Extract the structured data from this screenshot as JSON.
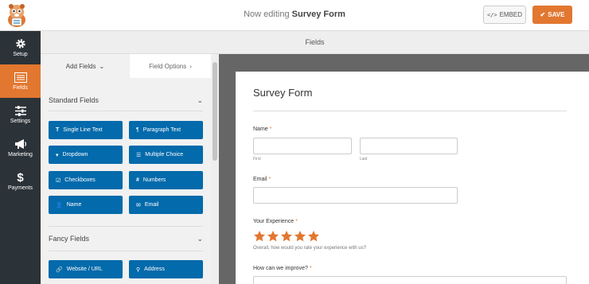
{
  "header": {
    "title_prefix": "Now editing",
    "form_name": "Survey Form",
    "embed_label": "EMBED",
    "save_label": "SAVE"
  },
  "nav": {
    "items": [
      {
        "label": "Setup",
        "icon": "gear-icon"
      },
      {
        "label": "Fields",
        "icon": "fields-icon"
      },
      {
        "label": "Settings",
        "icon": "sliders-icon"
      },
      {
        "label": "Marketing",
        "icon": "megaphone-icon"
      },
      {
        "label": "Payments",
        "icon": "dollar-icon"
      }
    ]
  },
  "fields_bar": {
    "title": "Fields"
  },
  "panel": {
    "tabs": [
      {
        "label": "Add Fields",
        "icon": "chevron-down-icon"
      },
      {
        "label": "Field Options",
        "icon": "chevron-right-icon"
      }
    ],
    "standard_fields": {
      "title": "Standard Fields",
      "buttons": [
        {
          "label": "Single Line Text",
          "icon": "text-icon"
        },
        {
          "label": "Paragraph Text",
          "icon": "paragraph-icon"
        },
        {
          "label": "Dropdown",
          "icon": "dropdown-icon"
        },
        {
          "label": "Multiple Choice",
          "icon": "list-icon"
        },
        {
          "label": "Checkboxes",
          "icon": "checkbox-icon"
        },
        {
          "label": "Numbers",
          "icon": "hash-icon"
        },
        {
          "label": "Name",
          "icon": "user-icon"
        },
        {
          "label": "Email",
          "icon": "envelope-icon"
        }
      ]
    },
    "fancy_fields": {
      "title": "Fancy Fields",
      "buttons": [
        {
          "label": "Website / URL",
          "icon": "link-icon"
        },
        {
          "label": "Address",
          "icon": "map-marker-icon"
        }
      ]
    }
  },
  "form": {
    "title": "Survey Form",
    "name_label": "Name",
    "first_sublabel": "First",
    "last_sublabel": "Last",
    "email_label": "Email",
    "experience_label": "Your Experience",
    "rating": 5,
    "rating_max": 5,
    "experience_desc": "Overall, how would you rate your experience with us?",
    "improve_label": "How can we improve?",
    "required_mark": "*"
  },
  "colors": {
    "accent": "#e27730",
    "field_button": "#036aab",
    "nav_bg": "#2c3338"
  }
}
